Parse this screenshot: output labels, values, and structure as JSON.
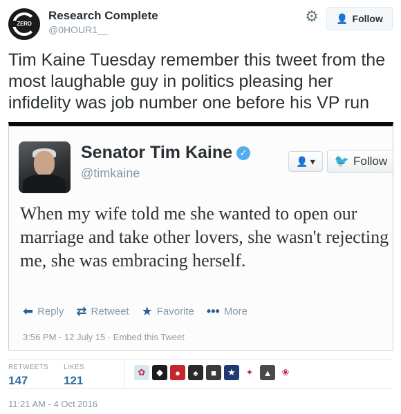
{
  "header": {
    "avatar_logo_text": "ZERO",
    "display_name": "Research Complete",
    "handle": "@0HOUR1__",
    "gear_icon": "gear-icon",
    "follow_label": "Follow"
  },
  "tweet": {
    "text": "Tim Kaine Tuesday remember this tweet from the most laughable guy in politics pleasing her infidelity was job number one before his VP run"
  },
  "embedded_tweet": {
    "display_name": "Senator Tim Kaine",
    "verified_icon": "verified-badge-icon",
    "handle": "@timkaine",
    "follow_label": "Follow",
    "text": "When my wife told me she wanted to open our marriage and take other lovers, she wasn't rejecting me, she was embracing herself.",
    "actions": {
      "reply": "Reply",
      "retweet": "Retweet",
      "favorite": "Favorite",
      "more": "More"
    },
    "meta": "3:56 PM - 12 July 15 · Embed this Tweet"
  },
  "stats": {
    "retweets_label": "RETWEETS",
    "retweets_value": "147",
    "likes_label": "LIKES",
    "likes_value": "121"
  },
  "likers": [
    {
      "name": "liker-avatar",
      "color": "#d8e6ef",
      "glyph": "✿"
    },
    {
      "name": "liker-avatar",
      "color": "#1c1c1c",
      "glyph": "◆"
    },
    {
      "name": "liker-avatar",
      "color": "#c4262e",
      "glyph": "●"
    },
    {
      "name": "liker-avatar",
      "color": "#2a2a2a",
      "glyph": "♠"
    },
    {
      "name": "liker-avatar",
      "color": "#3b3b3b",
      "glyph": "■"
    },
    {
      "name": "liker-avatar",
      "color": "#1f3a73",
      "glyph": "★"
    },
    {
      "name": "liker-avatar",
      "color": "#ffffff",
      "glyph": "✦"
    },
    {
      "name": "liker-avatar",
      "color": "#4a4a4a",
      "glyph": "▲"
    },
    {
      "name": "liker-avatar",
      "color": "#ffffff",
      "glyph": "❀"
    }
  ],
  "timestamp": "11:21 AM - 4 Oct 2016"
}
